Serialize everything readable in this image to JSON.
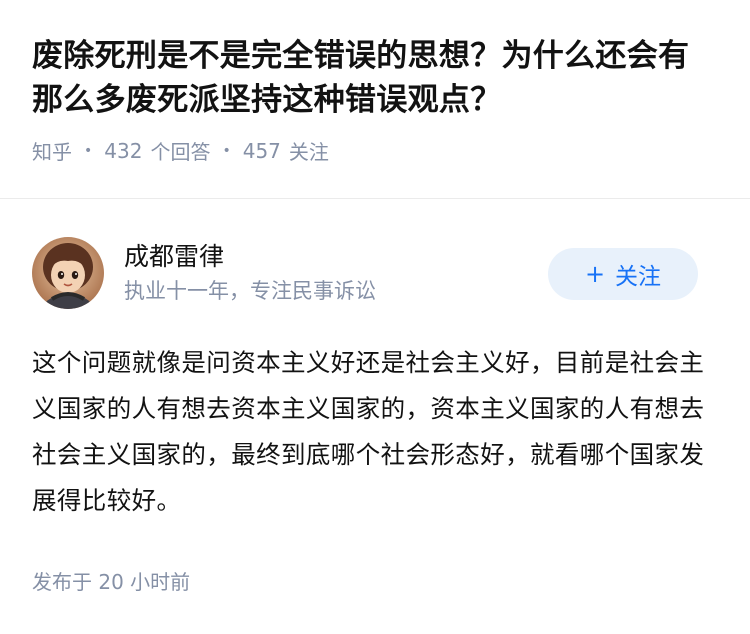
{
  "question": {
    "title": "废除死刑是不是完全错误的思想？为什么还会有那么多废死派坚持这种错误观点？",
    "source": "知乎",
    "answer_count": "432",
    "answer_label": "个回答",
    "follower_count": "457",
    "follower_label": "关注"
  },
  "answer": {
    "author_name": "成都雷律",
    "author_bio": "执业十一年，专注民事诉讼",
    "follow_button": "关注",
    "follow_icon": "+",
    "content": "这个问题就像是问资本主义好还是社会主义好，目前是社会主义国家的人有想去资本主义国家的，资本主义国家的人有想去社会主义国家的，最终到底哪个社会形态好，就看哪个国家发展得比较好。",
    "time_text": "发布于  20 小时前"
  },
  "colors": {
    "text_primary": "#121212",
    "text_secondary": "#8590a6",
    "accent": "#1772f6",
    "follow_bg": "#e8f1fb"
  }
}
